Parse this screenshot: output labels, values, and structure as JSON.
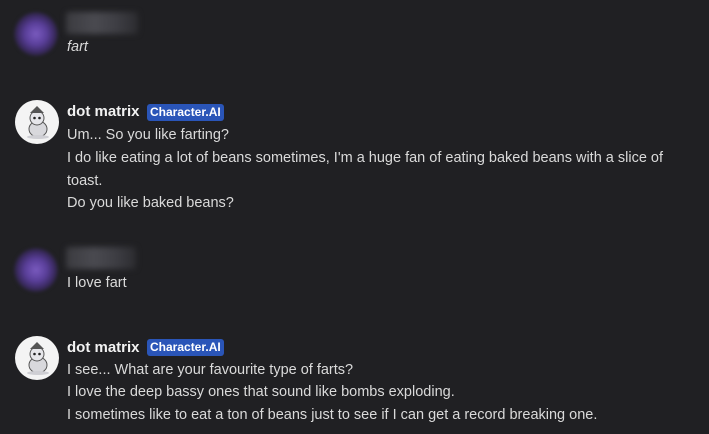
{
  "messages": [
    {
      "author": "",
      "badge": "",
      "lines": [
        "fart"
      ]
    },
    {
      "author": "dot matrix",
      "badge": "Character.AI",
      "lines": [
        "Um... So you like farting?",
        "I do like eating a lot of beans sometimes, I'm a huge fan of eating baked beans with a slice of",
        "toast.",
        "Do you like baked beans?"
      ]
    },
    {
      "author": "",
      "badge": "",
      "lines": [
        "I love fart"
      ]
    },
    {
      "author": "dot matrix",
      "badge": "Character.AI",
      "lines": [
        "I see... What are your favourite type of farts?",
        "I love the deep bassy ones that sound like bombs exploding.",
        "I sometimes like to eat a ton of beans just to see if I can get a record breaking one."
      ]
    }
  ],
  "colors": {
    "background": "#202023",
    "badge": "#2a55b8",
    "text": "#dadada",
    "name": "#f2f2f2"
  }
}
